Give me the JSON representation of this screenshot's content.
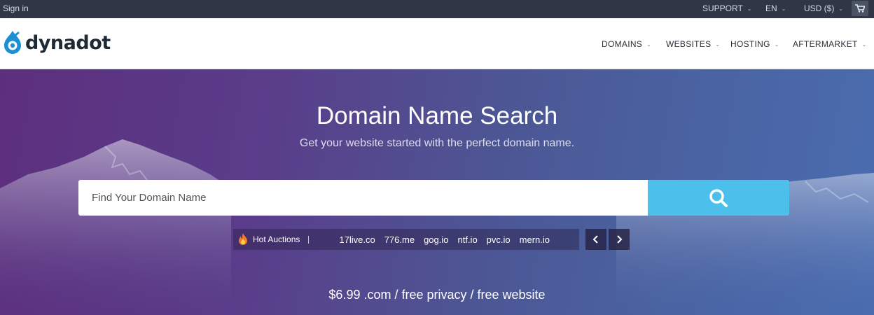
{
  "topbar": {
    "signin": "Sign in",
    "support": "SUPPORT",
    "language": "EN",
    "currency": "USD ($)",
    "cart_icon": "cart-icon"
  },
  "header": {
    "logo_text": "dynadot",
    "nav": [
      "DOMAINS",
      "WEBSITES",
      "HOSTING",
      "AFTERMARKET"
    ]
  },
  "hero": {
    "title": "Domain Name Search",
    "subtitle": "Get your website started with the perfect domain name.",
    "search": {
      "placeholder": "Find Your Domain Name",
      "button_icon": "search-icon"
    },
    "auctions": {
      "label": "Hot Auctions",
      "domains": [
        "17live.co",
        "776.me",
        "gog.io",
        "ntf.io",
        "pvc.io",
        "mern.io"
      ]
    },
    "promo": "$6.99 .com / free privacy / free website"
  },
  "colors": {
    "topbar_bg": "#2f3747",
    "search_button": "#4cc0ea",
    "logo_blue": "#1a8fd6",
    "hero_purple": "#5c2f7e",
    "hero_blue": "#4a6db0"
  }
}
